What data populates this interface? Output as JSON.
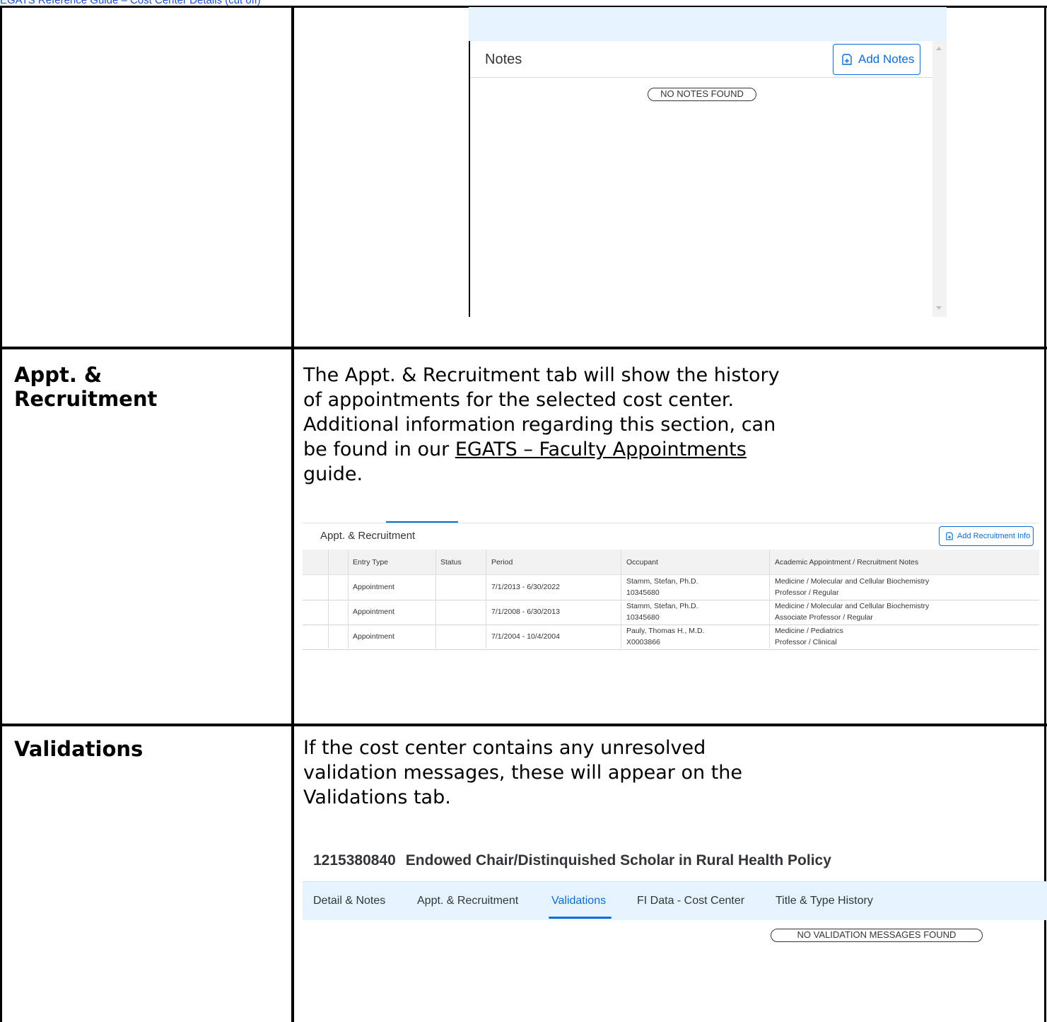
{
  "top_link_text": "EGATS Reference Guide – Cost Center Details (cut off)",
  "notes_panel": {
    "title": "Notes",
    "add_button": "Add Notes",
    "empty_message": "NO NOTES FOUND"
  },
  "rows": [
    {
      "title_line1": "Appt. &",
      "title_line2": "Recruitment",
      "desc_lines": [
        "The Appt. & Recruitment tab will show the history",
        "of appointments for the selected cost center.",
        "Additional information regarding this section, can"
      ],
      "desc_pre_link": "be found in our ",
      "desc_link": "EGATS – Faculty Appointments",
      "desc_post": "guide."
    },
    {
      "title": "Validations",
      "desc_lines": [
        "If the cost center contains any unresolved",
        "validation messages, these will appear on the",
        "Validations tab."
      ]
    }
  ],
  "appt_panel": {
    "title": "Appt. & Recruitment",
    "add_button": "Add Recruitment Info",
    "columns": [
      "Entry Type",
      "Status",
      "Period",
      "Occupant",
      "Academic Appointment / Recruitment Notes"
    ],
    "rows": [
      {
        "entry_type": "Appointment",
        "status": "",
        "period": "7/1/2013 - 6/30/2022",
        "occupant_name": "Stamm, Stefan, Ph.D.",
        "occupant_id": "10345680",
        "notes_line1": "Medicine / Molecular and Cellular Biochemistry",
        "notes_line2": "Professor / Regular"
      },
      {
        "entry_type": "Appointment",
        "status": "",
        "period": "7/1/2008 - 6/30/2013",
        "occupant_name": "Stamm, Stefan, Ph.D.",
        "occupant_id": "10345680",
        "notes_line1": "Medicine / Molecular and Cellular Biochemistry",
        "notes_line2": "Associate Professor / Regular"
      },
      {
        "entry_type": "Appointment",
        "status": "",
        "period": "7/1/2004 - 10/4/2004",
        "occupant_name": "Pauly, Thomas H., M.D.",
        "occupant_id": "X0003866",
        "notes_line1": "Medicine / Pediatrics",
        "notes_line2": "Professor / Clinical"
      }
    ]
  },
  "validations_panel": {
    "cost_center_id": "1215380840",
    "cost_center_name": "Endowed Chair/Distinquished Scholar in Rural Health Policy",
    "tabs": [
      "Detail & Notes",
      "Appt. & Recruitment",
      "Validations",
      "FI Data - Cost Center",
      "Title & Type History"
    ],
    "active_tab": "Validations",
    "empty_message": "NO VALIDATION MESSAGES FOUND"
  },
  "colors": {
    "accent": "#0a6ed1",
    "header_band": "#e5f4fc",
    "text": "#32363a"
  }
}
